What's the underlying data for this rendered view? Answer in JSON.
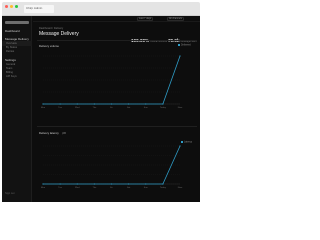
{
  "browser": {
    "tab_title": "Chirp Admin",
    "colors": {
      "close": "#ff5f57",
      "minimize": "#febc2e",
      "zoom": "#28c840"
    }
  },
  "sidebar": {
    "brand_icon": "logo-bar",
    "groups": [
      {
        "label": "Dashboard"
      },
      {
        "label": "Message Delivery",
        "items": [
          {
            "label": "Overview"
          },
          {
            "label": "By Status"
          },
          {
            "label": "Retries"
          }
        ]
      },
      {
        "label": "Settings",
        "items": [
          {
            "label": "General"
          },
          {
            "label": "Team"
          },
          {
            "label": "Billing"
          },
          {
            "label": "API Keys"
          }
        ]
      }
    ],
    "footer": "Sign out"
  },
  "topbar": {
    "range_label": "Last 7 days",
    "filter_label": "All channels"
  },
  "header": {
    "breadcrumb": "Dashboard / Delivery",
    "title": "Message Delivery",
    "stats": [
      {
        "value": "100.00%",
        "label": "Overall success"
      },
      {
        "value": "70.9k",
        "label": "Messages sent"
      }
    ]
  },
  "charts": [
    {
      "title": "Delivery volume",
      "legend": [
        {
          "label": "Delivered",
          "color": "#2f9ec9"
        }
      ],
      "categories": [
        "Mon",
        "Tue",
        "Wed",
        "Thu",
        "Fri",
        "Sat",
        "Sun",
        "Today",
        "Now"
      ],
      "accent": "#2f9ec9"
    },
    {
      "title": "Delivery latency",
      "subtitle": "p95",
      "legend": [
        {
          "label": "Latency",
          "color": "#2f9ec9"
        }
      ],
      "accent": "#2f9ec9"
    }
  ],
  "chart_data": [
    {
      "type": "line",
      "x": [
        "Mon",
        "Tue",
        "Wed",
        "Thu",
        "Fri",
        "Sat",
        "Sun",
        "Today",
        "Now"
      ],
      "series": [
        {
          "name": "Delivered",
          "values": [
            0,
            0,
            0,
            0,
            0,
            0,
            0,
            0,
            1
          ]
        }
      ],
      "ylim": [
        0,
        1
      ],
      "grid": true,
      "legend": "top-right"
    },
    {
      "type": "line",
      "x": [
        "Mon",
        "Tue",
        "Wed",
        "Thu",
        "Fri",
        "Sat",
        "Sun",
        "Today",
        "Now"
      ],
      "series": [
        {
          "name": "Latency",
          "values": [
            0,
            0,
            0,
            0,
            0,
            0,
            0,
            0,
            1
          ]
        }
      ],
      "ylim": [
        0,
        1
      ],
      "grid": true,
      "legend": "top-right"
    }
  ]
}
